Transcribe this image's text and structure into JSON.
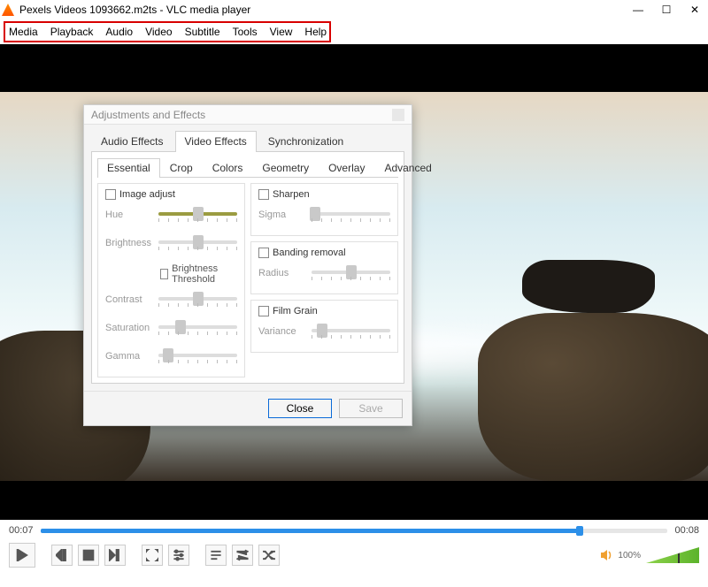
{
  "titlebar": {
    "title": "Pexels Videos 1093662.m2ts - VLC media player"
  },
  "menu": {
    "items": [
      "Media",
      "Playback",
      "Audio",
      "Video",
      "Subtitle",
      "Tools",
      "View",
      "Help"
    ]
  },
  "dialog": {
    "title": "Adjustments and Effects",
    "tabs1": [
      "Audio Effects",
      "Video Effects",
      "Synchronization"
    ],
    "tabs1_active": 1,
    "tabs2": [
      "Essential",
      "Crop",
      "Colors",
      "Geometry",
      "Overlay",
      "Advanced"
    ],
    "tabs2_active": 0,
    "left": {
      "image_adjust": "Image adjust",
      "hue": "Hue",
      "brightness": "Brightness",
      "brightness_threshold": "Brightness Threshold",
      "contrast": "Contrast",
      "saturation": "Saturation",
      "gamma": "Gamma"
    },
    "right": {
      "sharpen": "Sharpen",
      "sigma": "Sigma",
      "banding": "Banding removal",
      "radius": "Radius",
      "filmgrain": "Film Grain",
      "variance": "Variance"
    },
    "buttons": {
      "close": "Close",
      "save": "Save"
    }
  },
  "player": {
    "time_elapsed": "00:07",
    "time_total": "00:08",
    "seek_pct": 86,
    "volume_pct": "100%"
  }
}
